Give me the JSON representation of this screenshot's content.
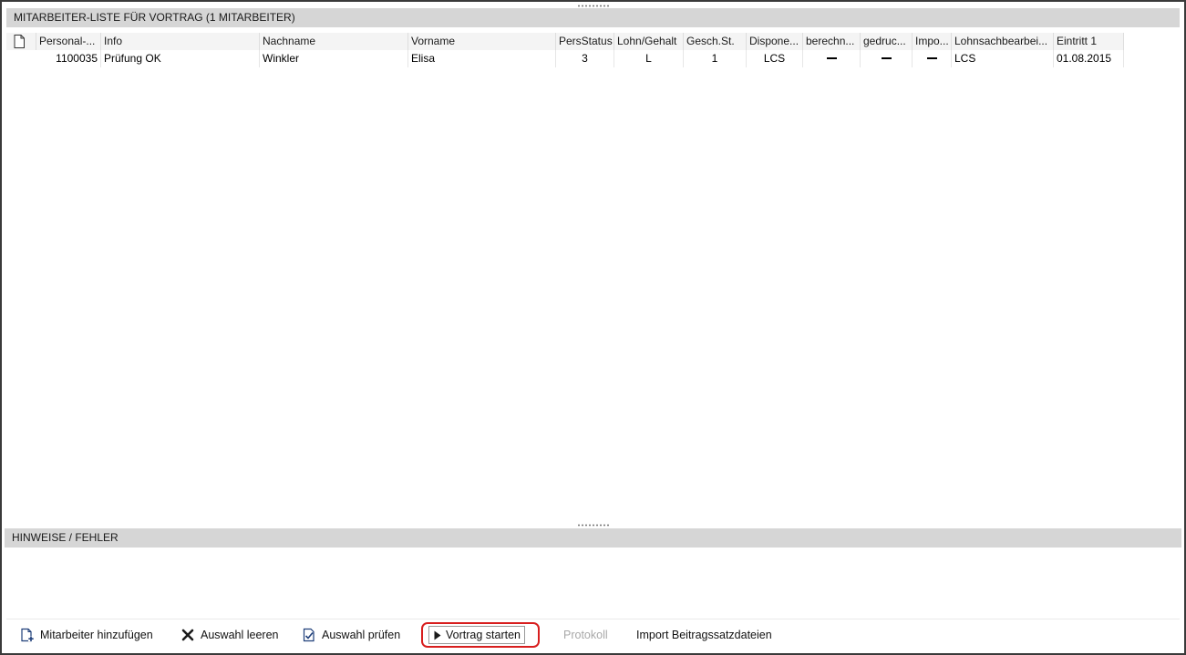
{
  "employee_list": {
    "title": "MITARBEITER-LISTE FÜR VORTRAG (1 MITARBEITER)",
    "columns": [
      "Personal-...",
      "Info",
      "Nachname",
      "Vorname",
      "PersStatus",
      "Lohn/Gehalt",
      "Gesch.St.",
      "Dispone...",
      "berechn...",
      "gedruc...",
      "Impo...",
      "Lohnsachbearbei...",
      "Eintritt 1"
    ],
    "rows": [
      {
        "personal_nr": "1100035",
        "info": "Prüfung OK",
        "nachname": "Winkler",
        "vorname": "Elisa",
        "pers_status": "3",
        "lohn_gehalt": "L",
        "gesch_st": "1",
        "disponent": "LCS",
        "berechnet": false,
        "gedruckt": false,
        "importiert": false,
        "lohnsachbearbeiter": "LCS",
        "eintritt": "01.08.2015"
      }
    ]
  },
  "hints": {
    "title": "HINWEISE / FEHLER"
  },
  "toolbar": {
    "add_employee": "Mitarbeiter hinzufügen",
    "clear_selection": "Auswahl leeren",
    "check_selection": "Auswahl prüfen",
    "start_transfer": "Vortrag starten",
    "protocol": "Protokoll",
    "import_contribution_files": "Import Beitragssatzdateien"
  },
  "colors": {
    "section_header_bg": "#d6d6d6",
    "highlight_border": "#d81e1e",
    "disabled_text": "#a8a8a8"
  }
}
